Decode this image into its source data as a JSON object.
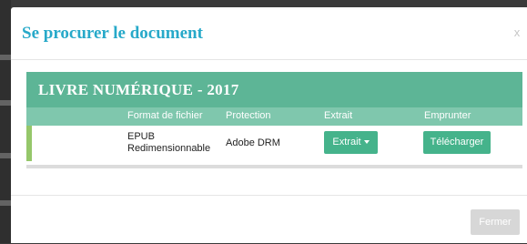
{
  "modal": {
    "title": "Se procurer le document",
    "close_label": "x"
  },
  "panel": {
    "title": "LIVRE NUMÉRIQUE - 2017",
    "columns": [
      "Format de fichier",
      "Protection",
      "Extrait",
      "Emprunter"
    ],
    "row": {
      "format_line1": "EPUB",
      "format_line2": "Redimensionnable",
      "protection": "Adobe DRM",
      "extrait_button": "Extrait",
      "emprunter_button": "Télécharger"
    }
  },
  "footer": {
    "close_button": "Fermer"
  },
  "colors": {
    "title_blue": "#27a9c9",
    "header_green": "#5db596",
    "subheader_green": "#7fc7ad",
    "button_green": "#45b38b",
    "row_marker": "#95c76a"
  }
}
